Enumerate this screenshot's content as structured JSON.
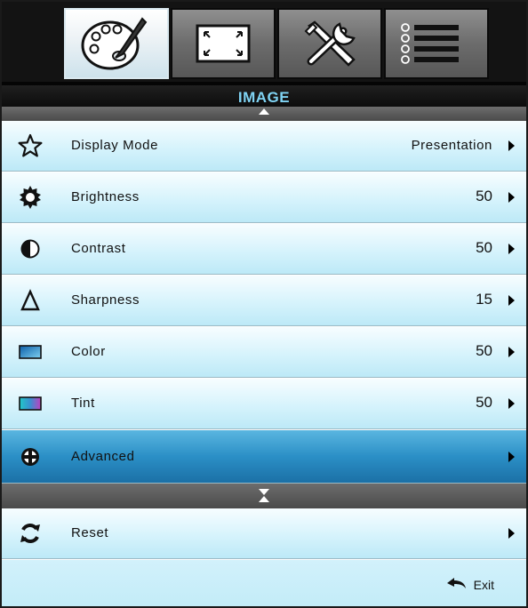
{
  "tabs": [
    {
      "icon": "palette-icon",
      "active": true
    },
    {
      "icon": "screen-resize-icon",
      "active": false
    },
    {
      "icon": "tools-icon",
      "active": false
    },
    {
      "icon": "options-list-icon",
      "active": false
    }
  ],
  "section": {
    "title": "IMAGE"
  },
  "menu": {
    "items": [
      {
        "label": "Display Mode",
        "value": "Presentation",
        "icon": "star-icon"
      },
      {
        "label": "Brightness",
        "value": "50",
        "icon": "sun-icon"
      },
      {
        "label": "Contrast",
        "value": "50",
        "icon": "contrast-icon"
      },
      {
        "label": "Sharpness",
        "value": "15",
        "icon": "triangle-icon"
      },
      {
        "label": "Color",
        "value": "50",
        "icon": "color-swatch-icon"
      },
      {
        "label": "Tint",
        "value": "50",
        "icon": "tint-swatch-icon"
      },
      {
        "label": "Advanced",
        "value": "",
        "icon": "circle-plus-icon",
        "selected": true
      }
    ]
  },
  "reset": {
    "label": "Reset",
    "icon": "refresh-icon"
  },
  "footer": {
    "exit_label": "Exit",
    "icon": "return-arrow-icon"
  },
  "colors": {
    "accent_title": "#7fd3f3",
    "row_light": "#d6f3fc",
    "row_selected": "#2b8fc6",
    "tab_active": "#eef3f6",
    "tab_inactive": "#6c6c6c"
  }
}
